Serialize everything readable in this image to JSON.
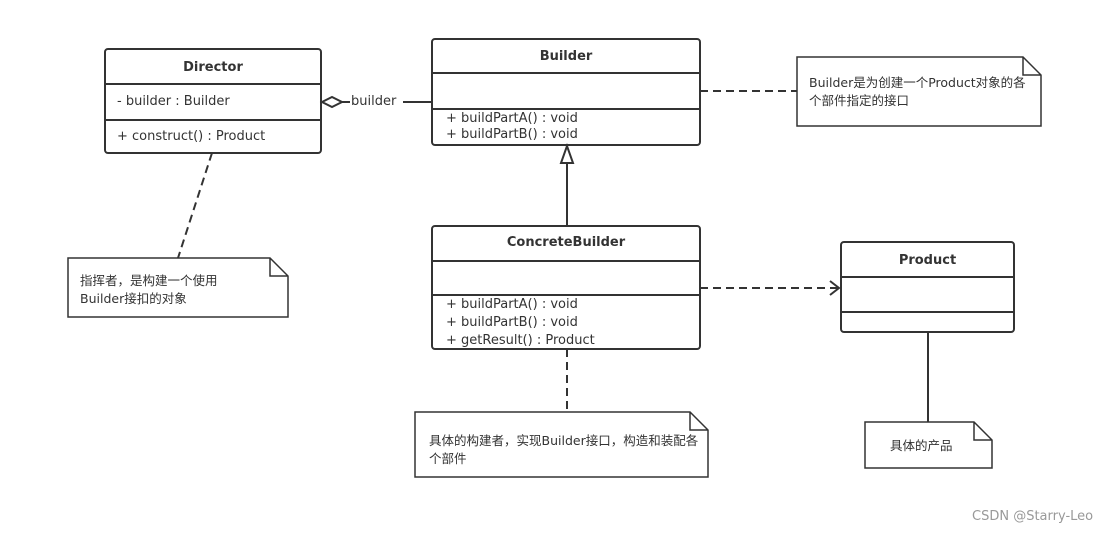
{
  "director": {
    "name": "Director",
    "attributes": [
      "- builder : Builder"
    ],
    "methods": [
      "+ construct()  : Product"
    ]
  },
  "builder": {
    "name": "Builder",
    "attributes": [],
    "methods": [
      "+ buildPartA() : void",
      "+ buildPartB() : void"
    ]
  },
  "concrete_builder": {
    "name": "ConcreteBuilder",
    "attributes": [],
    "methods": [
      "+ buildPartA() : void",
      "+ buildPartB() : void",
      "+ getResult() : Product"
    ]
  },
  "product": {
    "name": "Product",
    "attributes": [],
    "methods": []
  },
  "aggregation_label": "builder",
  "notes": {
    "builder": "Builder是为创建一个Product对象的各个部件指定的接口",
    "director": "指挥者，是构建一个使用Builder接扣的对象",
    "concrete_builder": "具体的构建者，实现Builder接口，构造和装配各个部件",
    "product": "具体的产品"
  },
  "watermark": "CSDN @Starry-Leo",
  "colors": {
    "stroke": "#333333",
    "text": "#333333"
  }
}
